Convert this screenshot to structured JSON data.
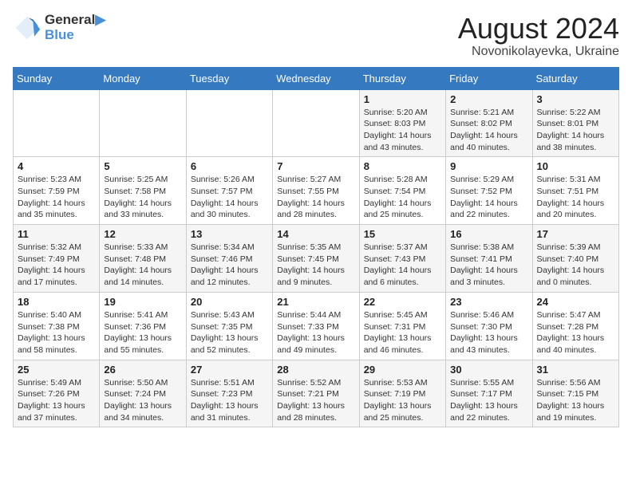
{
  "logo": {
    "line1": "General",
    "line2": "Blue"
  },
  "title": "August 2024",
  "subtitle": "Novonikolayevka, Ukraine",
  "days_of_week": [
    "Sunday",
    "Monday",
    "Tuesday",
    "Wednesday",
    "Thursday",
    "Friday",
    "Saturday"
  ],
  "weeks": [
    [
      {
        "day": "",
        "detail": ""
      },
      {
        "day": "",
        "detail": ""
      },
      {
        "day": "",
        "detail": ""
      },
      {
        "day": "",
        "detail": ""
      },
      {
        "day": "1",
        "detail": "Sunrise: 5:20 AM\nSunset: 8:03 PM\nDaylight: 14 hours\nand 43 minutes."
      },
      {
        "day": "2",
        "detail": "Sunrise: 5:21 AM\nSunset: 8:02 PM\nDaylight: 14 hours\nand 40 minutes."
      },
      {
        "day": "3",
        "detail": "Sunrise: 5:22 AM\nSunset: 8:01 PM\nDaylight: 14 hours\nand 38 minutes."
      }
    ],
    [
      {
        "day": "4",
        "detail": "Sunrise: 5:23 AM\nSunset: 7:59 PM\nDaylight: 14 hours\nand 35 minutes."
      },
      {
        "day": "5",
        "detail": "Sunrise: 5:25 AM\nSunset: 7:58 PM\nDaylight: 14 hours\nand 33 minutes."
      },
      {
        "day": "6",
        "detail": "Sunrise: 5:26 AM\nSunset: 7:57 PM\nDaylight: 14 hours\nand 30 minutes."
      },
      {
        "day": "7",
        "detail": "Sunrise: 5:27 AM\nSunset: 7:55 PM\nDaylight: 14 hours\nand 28 minutes."
      },
      {
        "day": "8",
        "detail": "Sunrise: 5:28 AM\nSunset: 7:54 PM\nDaylight: 14 hours\nand 25 minutes."
      },
      {
        "day": "9",
        "detail": "Sunrise: 5:29 AM\nSunset: 7:52 PM\nDaylight: 14 hours\nand 22 minutes."
      },
      {
        "day": "10",
        "detail": "Sunrise: 5:31 AM\nSunset: 7:51 PM\nDaylight: 14 hours\nand 20 minutes."
      }
    ],
    [
      {
        "day": "11",
        "detail": "Sunrise: 5:32 AM\nSunset: 7:49 PM\nDaylight: 14 hours\nand 17 minutes."
      },
      {
        "day": "12",
        "detail": "Sunrise: 5:33 AM\nSunset: 7:48 PM\nDaylight: 14 hours\nand 14 minutes."
      },
      {
        "day": "13",
        "detail": "Sunrise: 5:34 AM\nSunset: 7:46 PM\nDaylight: 14 hours\nand 12 minutes."
      },
      {
        "day": "14",
        "detail": "Sunrise: 5:35 AM\nSunset: 7:45 PM\nDaylight: 14 hours\nand 9 minutes."
      },
      {
        "day": "15",
        "detail": "Sunrise: 5:37 AM\nSunset: 7:43 PM\nDaylight: 14 hours\nand 6 minutes."
      },
      {
        "day": "16",
        "detail": "Sunrise: 5:38 AM\nSunset: 7:41 PM\nDaylight: 14 hours\nand 3 minutes."
      },
      {
        "day": "17",
        "detail": "Sunrise: 5:39 AM\nSunset: 7:40 PM\nDaylight: 14 hours\nand 0 minutes."
      }
    ],
    [
      {
        "day": "18",
        "detail": "Sunrise: 5:40 AM\nSunset: 7:38 PM\nDaylight: 13 hours\nand 58 minutes."
      },
      {
        "day": "19",
        "detail": "Sunrise: 5:41 AM\nSunset: 7:36 PM\nDaylight: 13 hours\nand 55 minutes."
      },
      {
        "day": "20",
        "detail": "Sunrise: 5:43 AM\nSunset: 7:35 PM\nDaylight: 13 hours\nand 52 minutes."
      },
      {
        "day": "21",
        "detail": "Sunrise: 5:44 AM\nSunset: 7:33 PM\nDaylight: 13 hours\nand 49 minutes."
      },
      {
        "day": "22",
        "detail": "Sunrise: 5:45 AM\nSunset: 7:31 PM\nDaylight: 13 hours\nand 46 minutes."
      },
      {
        "day": "23",
        "detail": "Sunrise: 5:46 AM\nSunset: 7:30 PM\nDaylight: 13 hours\nand 43 minutes."
      },
      {
        "day": "24",
        "detail": "Sunrise: 5:47 AM\nSunset: 7:28 PM\nDaylight: 13 hours\nand 40 minutes."
      }
    ],
    [
      {
        "day": "25",
        "detail": "Sunrise: 5:49 AM\nSunset: 7:26 PM\nDaylight: 13 hours\nand 37 minutes."
      },
      {
        "day": "26",
        "detail": "Sunrise: 5:50 AM\nSunset: 7:24 PM\nDaylight: 13 hours\nand 34 minutes."
      },
      {
        "day": "27",
        "detail": "Sunrise: 5:51 AM\nSunset: 7:23 PM\nDaylight: 13 hours\nand 31 minutes."
      },
      {
        "day": "28",
        "detail": "Sunrise: 5:52 AM\nSunset: 7:21 PM\nDaylight: 13 hours\nand 28 minutes."
      },
      {
        "day": "29",
        "detail": "Sunrise: 5:53 AM\nSunset: 7:19 PM\nDaylight: 13 hours\nand 25 minutes."
      },
      {
        "day": "30",
        "detail": "Sunrise: 5:55 AM\nSunset: 7:17 PM\nDaylight: 13 hours\nand 22 minutes."
      },
      {
        "day": "31",
        "detail": "Sunrise: 5:56 AM\nSunset: 7:15 PM\nDaylight: 13 hours\nand 19 minutes."
      }
    ]
  ]
}
